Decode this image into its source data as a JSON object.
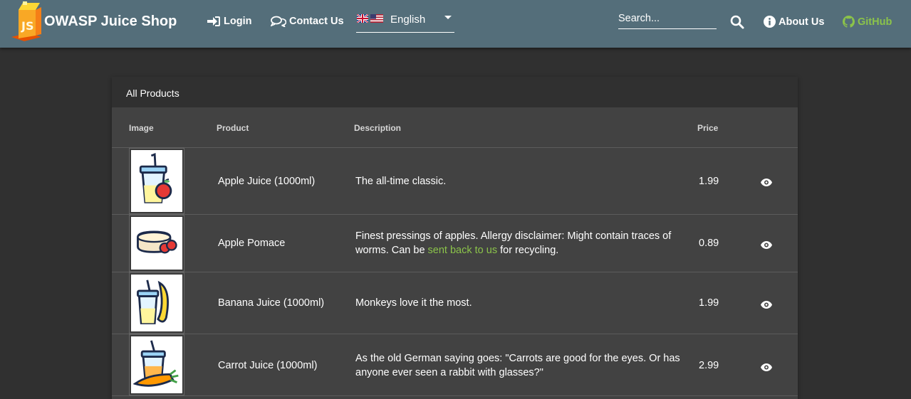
{
  "toolbar": {
    "app_title": "OWASP Juice Shop",
    "login_label": "Login",
    "contact_label": "Contact Us",
    "language_label": "English",
    "search_placeholder": "Search...",
    "about_label": "About Us",
    "github_label": "GitHub",
    "accent_color": "#8bc34a",
    "toolbar_color": "#546e7a"
  },
  "card": {
    "title": "All Products",
    "columns": {
      "image": "Image",
      "product": "Product",
      "description": "Description",
      "price": "Price"
    },
    "rows": [
      {
        "name": "Apple Juice (1000ml)",
        "description": "The all-time classic.",
        "price": "1.99",
        "icon": "apple-juice-image"
      },
      {
        "name": "Apple Pomace",
        "description_before": "Finest pressings of apples. Allergy disclaimer: Might contain traces of worms. Can be ",
        "description_link": "sent back to us",
        "description_after": " for recycling.",
        "price": "0.89",
        "icon": "apple-pomace-image"
      },
      {
        "name": "Banana Juice (1000ml)",
        "description": "Monkeys love it the most.",
        "price": "1.99",
        "icon": "banana-juice-image"
      },
      {
        "name": "Carrot Juice (1000ml)",
        "description": "As the old German saying goes: \"Carrots are good for the eyes. Or has anyone ever seen a rabbit with glasses?\"",
        "price": "2.99",
        "icon": "carrot-juice-image"
      }
    ]
  }
}
